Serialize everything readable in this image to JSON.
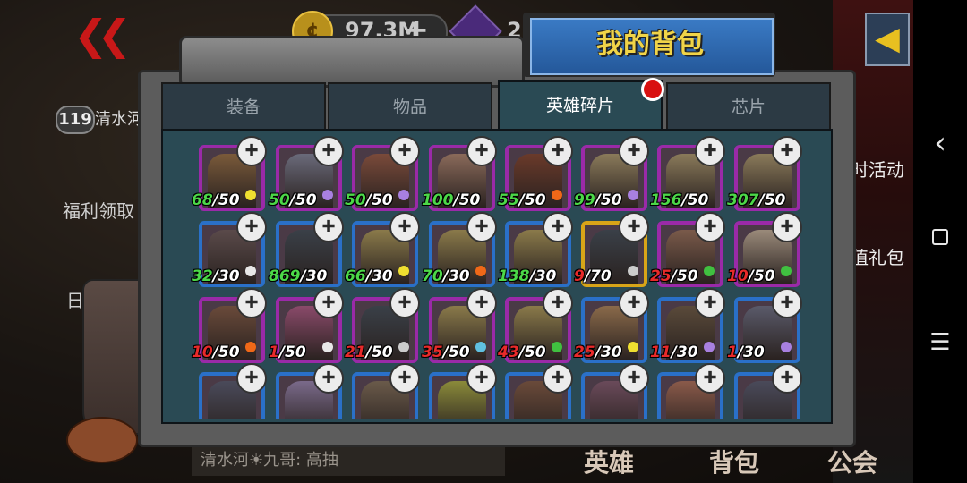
{
  "background": {
    "back_symbol": "❮❮",
    "level": "119",
    "player_name": "清水河",
    "welfare": "福利领取",
    "daily": "日常",
    "activity": "时活动",
    "gift": "值礼包",
    "chat": "清水河☀九哥: 高抽",
    "tabs": [
      "英雄",
      "背包",
      "公会"
    ],
    "coin_symbol": "¢",
    "coin_value": "97.3M",
    "plus_symbol": "+",
    "gem_value": "2",
    "right_arrow": "◀"
  },
  "modal": {
    "title": "我的背包",
    "tabs": [
      "装备",
      "物品",
      "英雄碎片",
      "芯片"
    ],
    "active_tab": 2
  },
  "cards": [
    {
      "have": "68",
      "need": "/50",
      "frame": "purple",
      "elem": "sun",
      "hue": "#7a5a3a"
    },
    {
      "have": "50",
      "need": "/50",
      "frame": "purple",
      "elem": "orb",
      "hue": "#6a6a7a"
    },
    {
      "have": "50",
      "need": "/50",
      "frame": "purple",
      "elem": "orb",
      "hue": "#7a4a3a"
    },
    {
      "have": "100",
      "need": "/50",
      "frame": "purple",
      "elem": "none",
      "hue": "#8a6a5a"
    },
    {
      "have": "55",
      "need": "/50",
      "frame": "purple",
      "elem": "fire",
      "hue": "#6a3a2a"
    },
    {
      "have": "99",
      "need": "/50",
      "frame": "purple",
      "elem": "orb",
      "hue": "#8a7a5a"
    },
    {
      "have": "156",
      "need": "/50",
      "frame": "purple",
      "elem": "none",
      "hue": "#8a7a5a"
    },
    {
      "have": "307",
      "need": "/50",
      "frame": "purple",
      "elem": "none",
      "hue": "#8a7a5a"
    },
    {
      "have": "32",
      "need": "/30",
      "frame": "blue",
      "elem": "bolt",
      "hue": "#5a4a4a"
    },
    {
      "have": "869",
      "need": "/30",
      "frame": "blue",
      "elem": "none",
      "hue": "#3a4048"
    },
    {
      "have": "66",
      "need": "/30",
      "frame": "blue",
      "elem": "sun",
      "hue": "#8a7a4a"
    },
    {
      "have": "70",
      "need": "/30",
      "frame": "blue",
      "elem": "fire",
      "hue": "#8a7a4a"
    },
    {
      "have": "138",
      "need": "/30",
      "frame": "blue",
      "elem": "none",
      "hue": "#8a7a4a"
    },
    {
      "have": "9",
      "need": "/70",
      "frame": "gold",
      "elem": "unknown",
      "hue": "#3a4048",
      "red": true
    },
    {
      "have": "25",
      "need": "/50",
      "frame": "purple",
      "elem": "leaf",
      "hue": "#7a5a4a",
      "red": true
    },
    {
      "have": "10",
      "need": "/50",
      "frame": "purple",
      "elem": "leaf",
      "hue": "#9a8a7a",
      "red": true
    },
    {
      "have": "10",
      "need": "/50",
      "frame": "purple",
      "elem": "fire",
      "hue": "#6a4a3a",
      "red": true
    },
    {
      "have": "1",
      "need": "/50",
      "frame": "purple",
      "elem": "bolt",
      "hue": "#8a4a6a",
      "red": true
    },
    {
      "have": "21",
      "need": "/50",
      "frame": "purple",
      "elem": "unknown",
      "hue": "#3a4048",
      "red": true
    },
    {
      "have": "35",
      "need": "/50",
      "frame": "purple",
      "elem": "wave",
      "hue": "#8a7a4a",
      "red": true
    },
    {
      "have": "43",
      "need": "/50",
      "frame": "purple",
      "elem": "leaf",
      "hue": "#8a7a4a",
      "red": true
    },
    {
      "have": "25",
      "need": "/30",
      "frame": "blue",
      "elem": "sun",
      "hue": "#8a6a4a",
      "red": true
    },
    {
      "have": "11",
      "need": "/30",
      "frame": "blue",
      "elem": "orb",
      "hue": "#5a4a3a",
      "red": true
    },
    {
      "have": "1",
      "need": "/30",
      "frame": "blue",
      "elem": "orb",
      "hue": "#5a5a6a",
      "red": true
    },
    {
      "have": "",
      "need": "",
      "frame": "blue",
      "elem": "none",
      "hue": "#4a4a5a"
    },
    {
      "have": "",
      "need": "",
      "frame": "blue",
      "elem": "none",
      "hue": "#7a6a8a"
    },
    {
      "have": "",
      "need": "",
      "frame": "blue",
      "elem": "none",
      "hue": "#6a5a4a"
    },
    {
      "have": "",
      "need": "",
      "frame": "blue",
      "elem": "none",
      "hue": "#8a8a3a"
    },
    {
      "have": "",
      "need": "",
      "frame": "blue",
      "elem": "none",
      "hue": "#6a4a3a"
    },
    {
      "have": "",
      "need": "",
      "frame": "blue",
      "elem": "none",
      "hue": "#6a4a5a"
    },
    {
      "have": "",
      "need": "",
      "frame": "blue",
      "elem": "none",
      "hue": "#8a5a4a"
    },
    {
      "have": "",
      "need": "",
      "frame": "blue",
      "elem": "none",
      "hue": "#4a4a5a"
    }
  ],
  "puzzle_symbol": "✚",
  "element_colors": {
    "sun": "#f0e030",
    "orb": "#a880e0",
    "fire": "#f06818",
    "bolt": "#e8e8e8",
    "leaf": "#40c040",
    "wave": "#60c0e0",
    "unknown": "#cccccc"
  },
  "system_nav": {
    "back": "‹",
    "menu": "☰"
  }
}
